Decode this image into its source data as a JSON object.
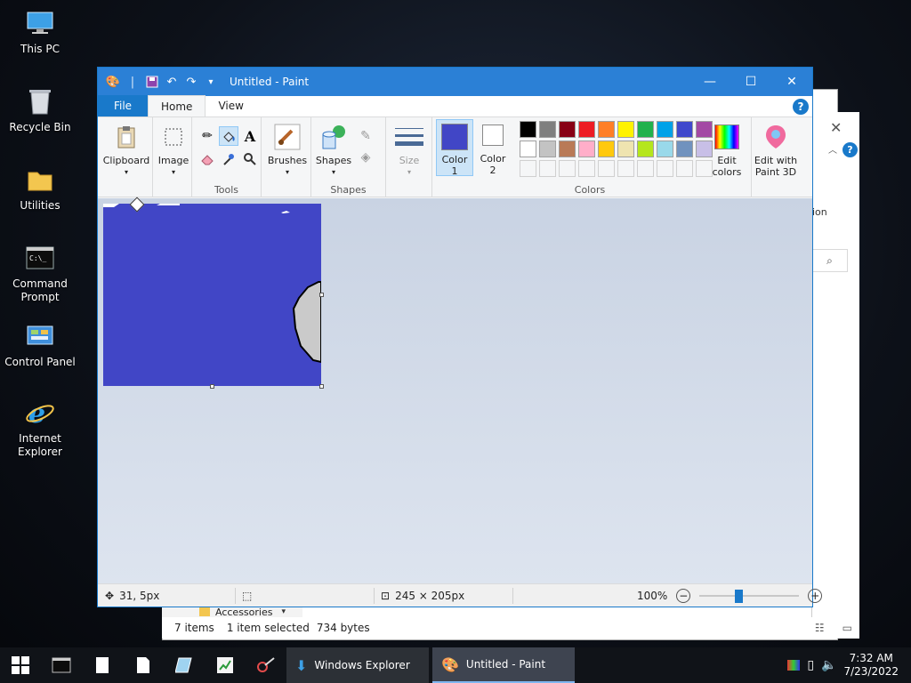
{
  "desktop": {
    "icons": [
      {
        "label": "This PC",
        "icon": "computer-icon"
      },
      {
        "label": "Recycle Bin",
        "icon": "recycle-bin-icon"
      },
      {
        "label": "Utilities",
        "icon": "folder-icon"
      },
      {
        "label": "Command Prompt",
        "icon": "cmd-icon"
      },
      {
        "label": "Control Panel",
        "icon": "control-panel-icon"
      },
      {
        "label": "Internet Explorer",
        "icon": "ie-icon"
      }
    ]
  },
  "explorer": {
    "breadcrumb_item": "Accessories",
    "side_text": "ion",
    "status": {
      "items": "7 items",
      "selected": "1 item selected",
      "size": "734 bytes"
    }
  },
  "paint": {
    "title": "Untitled - Paint",
    "tabs": {
      "file": "File",
      "home": "Home",
      "view": "View"
    },
    "ribbon": {
      "clipboard": "Clipboard",
      "image": "Image",
      "tools_label": "Tools",
      "brushes": "Brushes",
      "shapes": "Shapes",
      "shapes_group": "Shapes",
      "size": "Size",
      "color1": "Color 1",
      "color1_line1": "Color",
      "color1_line2": "1",
      "color2_line1": "Color",
      "color2_line2": "2",
      "edit_colors_line1": "Edit",
      "edit_colors_line2": "colors",
      "paint3d_line1": "Edit with",
      "paint3d_line2": "Paint 3D",
      "colors_label": "Colors"
    },
    "colors": {
      "color1": "#4146c6",
      "color2": "#ffffff",
      "palette_row1": [
        "#000000",
        "#7f7f7f",
        "#880015",
        "#ed1c24",
        "#ff7f27",
        "#fff200",
        "#22b14c",
        "#00a2e8",
        "#3f48cc",
        "#a349a4"
      ],
      "palette_row2": [
        "#ffffff",
        "#c3c3c3",
        "#b97a57",
        "#ffaec9",
        "#ffc90e",
        "#efe4b0",
        "#b5e61d",
        "#99d9ea",
        "#7092be",
        "#c8bfe7"
      ]
    },
    "status": {
      "cursor": "31, 5px",
      "image_size": "245 × 205px",
      "zoom": "100%"
    }
  },
  "taskbar": {
    "apps": [
      {
        "label": "Windows Explorer"
      },
      {
        "label": "Untitled - Paint"
      }
    ],
    "time": "7:32 AM",
    "date": "7/23/2022"
  }
}
